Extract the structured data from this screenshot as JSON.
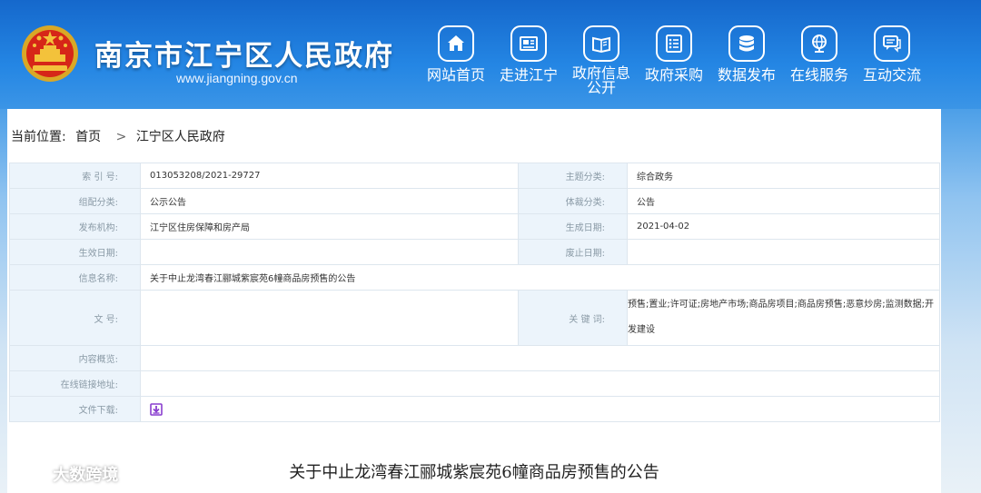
{
  "header": {
    "title": "南京市江宁区人民政府",
    "url": "www.jiangning.gov.cn",
    "emblem_icon": "national-emblem-icon"
  },
  "nav": [
    {
      "label": "网站首页",
      "icon": "home-icon"
    },
    {
      "label": "走进江宁",
      "icon": "newspaper-icon"
    },
    {
      "label": "政府信息公开",
      "icon": "open-book-icon"
    },
    {
      "label": "政府采购",
      "icon": "list-icon"
    },
    {
      "label": "数据发布",
      "icon": "database-icon"
    },
    {
      "label": "在线服务",
      "icon": "globe-icon"
    },
    {
      "label": "互动交流",
      "icon": "chat-icon"
    }
  ],
  "breadcrumb": {
    "prefix": "当前位置:",
    "home": "首页",
    "separator": ">",
    "current": "江宁区人民政府"
  },
  "info": {
    "index_no_label": "索 引 号:",
    "index_no": "013053208/2021-29727",
    "topic_label": "主题分类:",
    "topic": "综合政务",
    "category_label": "组配分类:",
    "category": "公示公告",
    "genre_label": "体裁分类:",
    "genre": "公告",
    "publisher_label": "发布机构:",
    "publisher": "江宁区住房保障和房产局",
    "created_label": "生成日期:",
    "created": "2021-04-02",
    "effective_label": "生效日期:",
    "effective": "",
    "repealed_label": "废止日期:",
    "repealed": "",
    "name_label": "信息名称:",
    "name": "关于中止龙湾春江郦城紫宸苑6幢商品房预售的公告",
    "doc_no_label": "文    号:",
    "doc_no": "",
    "keywords_label": "关 键 词:",
    "keywords": "预售;置业;许可证;房地产市场;商品房项目;商品房预售;恶意炒房;监测数据;开发建设",
    "summary_label": "内容概览:",
    "summary": "",
    "link_label": "在线链接地址:",
    "link": "",
    "download_label": "文件下载:"
  },
  "document": {
    "title": "关于中止龙湾春江郦城紫宸苑6幢商品房预售的公告"
  },
  "watermark": {
    "text": "大数跨境"
  },
  "colors": {
    "header_blue": "#1f7ad9",
    "label_bg": "#ecf4fb",
    "download_icon": "#8a3fcf"
  }
}
